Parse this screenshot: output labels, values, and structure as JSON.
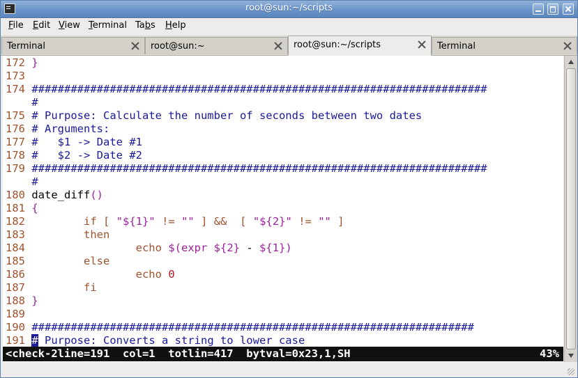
{
  "window": {
    "title": "root@sun:~/scripts"
  },
  "menu": [
    {
      "label": "File",
      "mnemonic": "F",
      "rest": "ile"
    },
    {
      "label": "Edit",
      "mnemonic": "E",
      "rest": "dit"
    },
    {
      "label": "View",
      "mnemonic": "V",
      "rest": "iew"
    },
    {
      "label": "Terminal",
      "mnemonic": "T",
      "rest": "erminal"
    },
    {
      "label": "Tabs",
      "mnemonic": "",
      "pre": "Ta",
      "mn2": "b",
      "rest": "s"
    },
    {
      "label": "Help",
      "mnemonic": "H",
      "rest": "elp"
    }
  ],
  "tabs": [
    {
      "label": "Terminal",
      "active": false
    },
    {
      "label": "root@sun:~",
      "active": false
    },
    {
      "label": "root@sun:~/scripts",
      "active": true
    },
    {
      "label": "Terminal",
      "active": false
    }
  ],
  "lines": [
    {
      "num": "172",
      "code": "}"
    },
    {
      "num": "173",
      "code": ""
    },
    {
      "num": "174",
      "code": "######################################################################"
    },
    {
      "num": "",
      "code": "#"
    },
    {
      "num": "175",
      "code": "# Purpose: Calculate the number of seconds between two dates"
    },
    {
      "num": "176",
      "code": "# Arguments:"
    },
    {
      "num": "177",
      "code": "#   $1 -> Date #1"
    },
    {
      "num": "178",
      "code": "#   $2 -> Date #2"
    },
    {
      "num": "179",
      "code": "######################################################################"
    },
    {
      "num": "",
      "code": "#"
    },
    {
      "num": "180",
      "code": "date_diff()"
    },
    {
      "num": "181",
      "code": "{"
    },
    {
      "num": "182",
      "code": "        if [ \"${1}\" != \"\" ] &&  [ \"${2}\" != \"\" ]"
    },
    {
      "num": "183",
      "code": "        then"
    },
    {
      "num": "184",
      "code": "                echo $(expr ${2} - ${1})"
    },
    {
      "num": "185",
      "code": "        else"
    },
    {
      "num": "186",
      "code": "                echo 0"
    },
    {
      "num": "187",
      "code": "        fi"
    },
    {
      "num": "188",
      "code": "}"
    },
    {
      "num": "189",
      "code": ""
    },
    {
      "num": "190",
      "code": "####################################################################"
    },
    {
      "num": "191",
      "code": "# Purpose: Converts a string to lower case"
    }
  ],
  "status": {
    "left": "<check-2line=191  col=1  totlin=417  bytval=0x23,1,SH",
    "right": "43%"
  }
}
